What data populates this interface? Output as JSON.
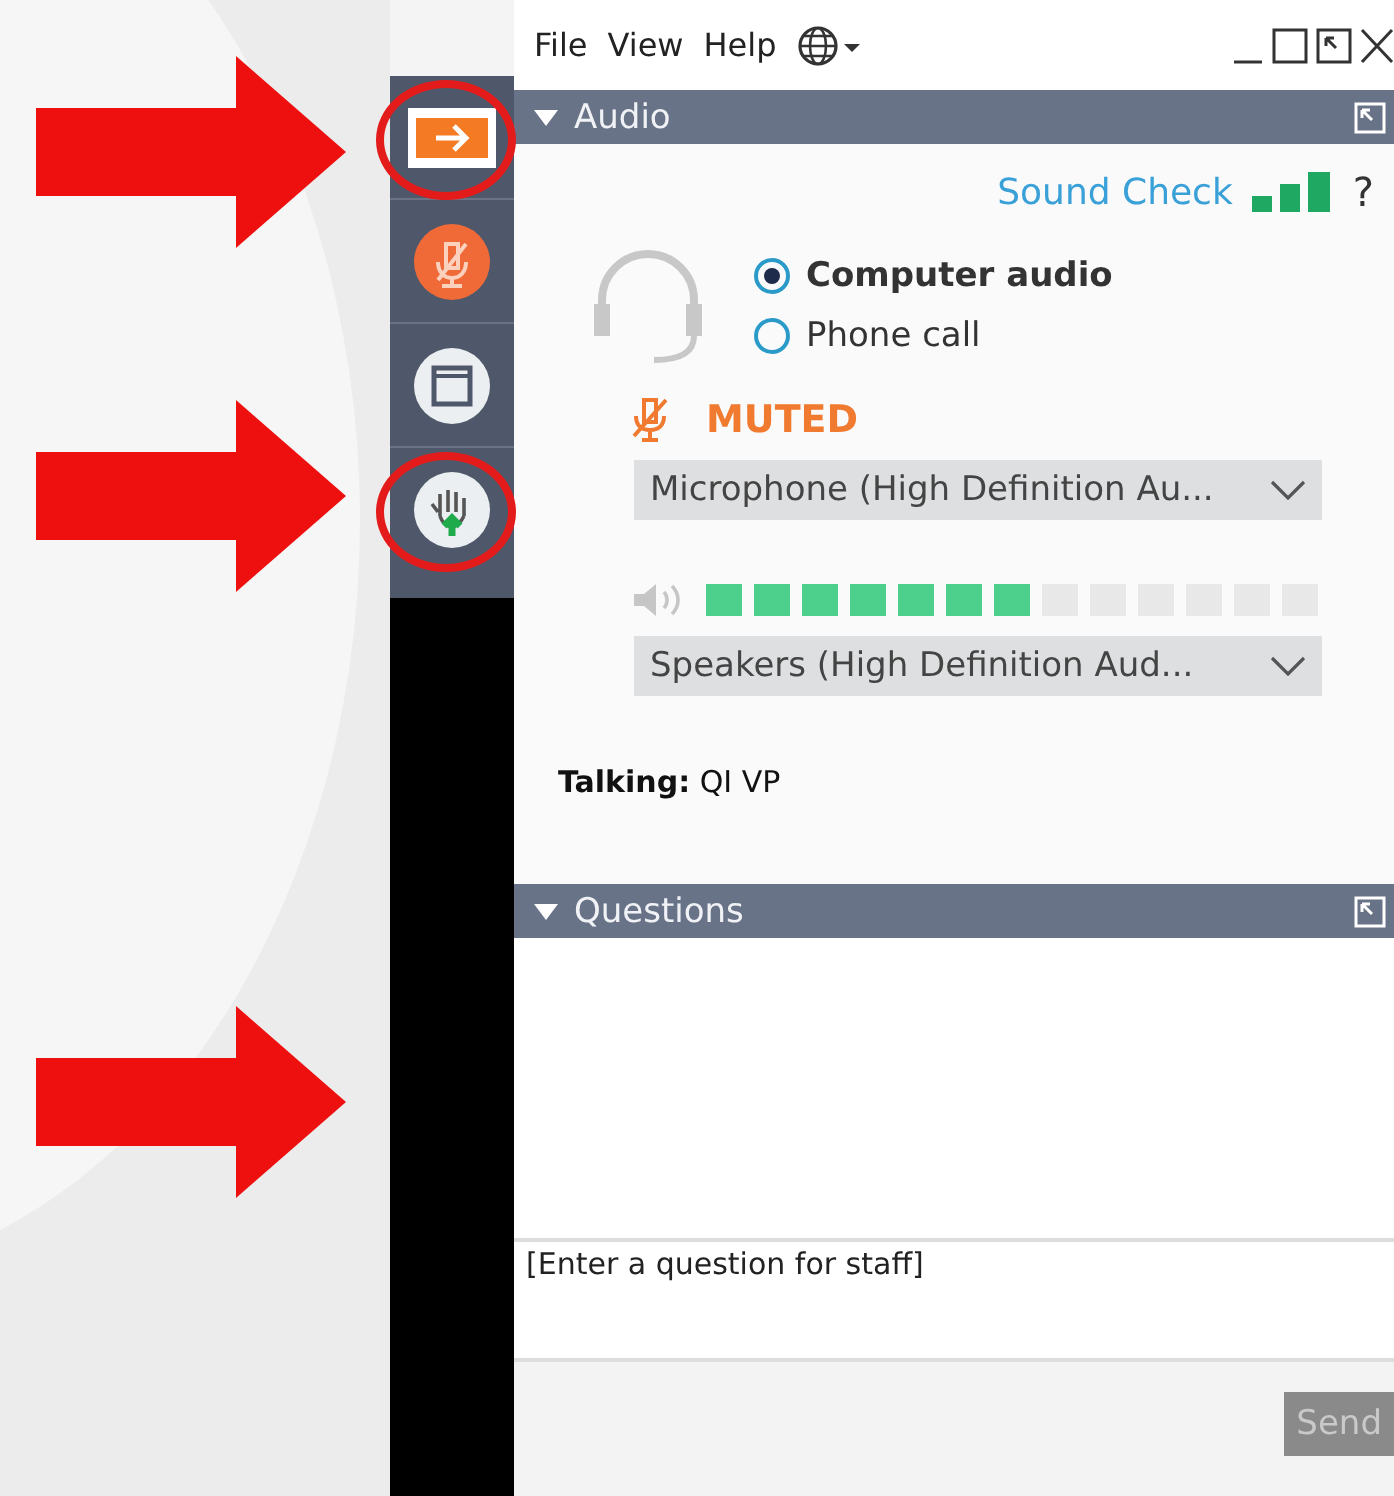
{
  "toolbar": [
    {
      "kind": "arrow",
      "highlighted": true
    },
    {
      "kind": "mic",
      "highlighted": false
    },
    {
      "kind": "window",
      "highlighted": false
    },
    {
      "kind": "hand",
      "highlighted": true
    }
  ],
  "menu": [
    "File",
    "View",
    "Help"
  ],
  "audio": {
    "title": "Audio",
    "sound_check": "Sound Check",
    "help": "?",
    "options": [
      {
        "label": "Computer audio",
        "selected": true
      },
      {
        "label": "Phone call",
        "selected": false
      }
    ],
    "muted": "MUTED",
    "microphone": "Microphone (High Definition Au...",
    "speaker_meter": {
      "level": 0.54
    },
    "speakers": "Speakers (High Definition Aud...",
    "talking": "**Talking:** QI VP"
  },
  "questions": {
    "title": "Questions",
    "placeholder": "[Enter a question for staff]",
    "send": {
      "label": "Send",
      "disabled": true
    }
  }
}
